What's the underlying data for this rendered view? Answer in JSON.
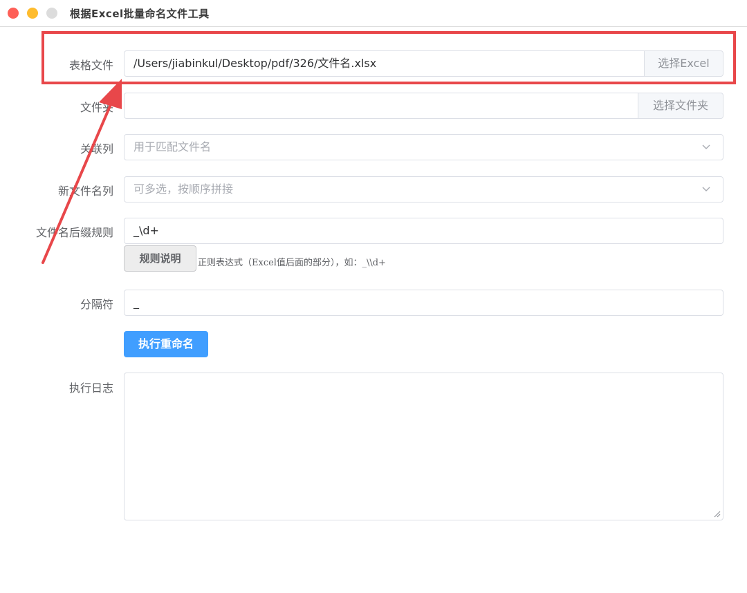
{
  "window": {
    "title": "根据Excel批量命名文件工具"
  },
  "form": {
    "excel_file": {
      "label": "表格文件",
      "value": "/Users/jiabinkul/Desktop/pdf/326/文件名.xlsx",
      "button": "选择Excel"
    },
    "folder": {
      "label": "文件夹",
      "value": "",
      "button": "选择文件夹"
    },
    "related_column": {
      "label": "关联列",
      "placeholder": "用于匹配文件名"
    },
    "new_name_columns": {
      "label": "新文件名列",
      "placeholder": "可多选，按顺序拼接"
    },
    "suffix_rule": {
      "label": "文件名后缀规则",
      "value": "_\\d+",
      "help_button": "规则说明",
      "hint": "正则表达式（Excel值后面的部分），如：_\\\\d+"
    },
    "separator": {
      "label": "分隔符",
      "value": "_"
    },
    "execute_button": "执行重命名",
    "log": {
      "label": "执行日志",
      "value": ""
    }
  },
  "colors": {
    "primary": "#409eff",
    "annotation": "#e8474a"
  }
}
